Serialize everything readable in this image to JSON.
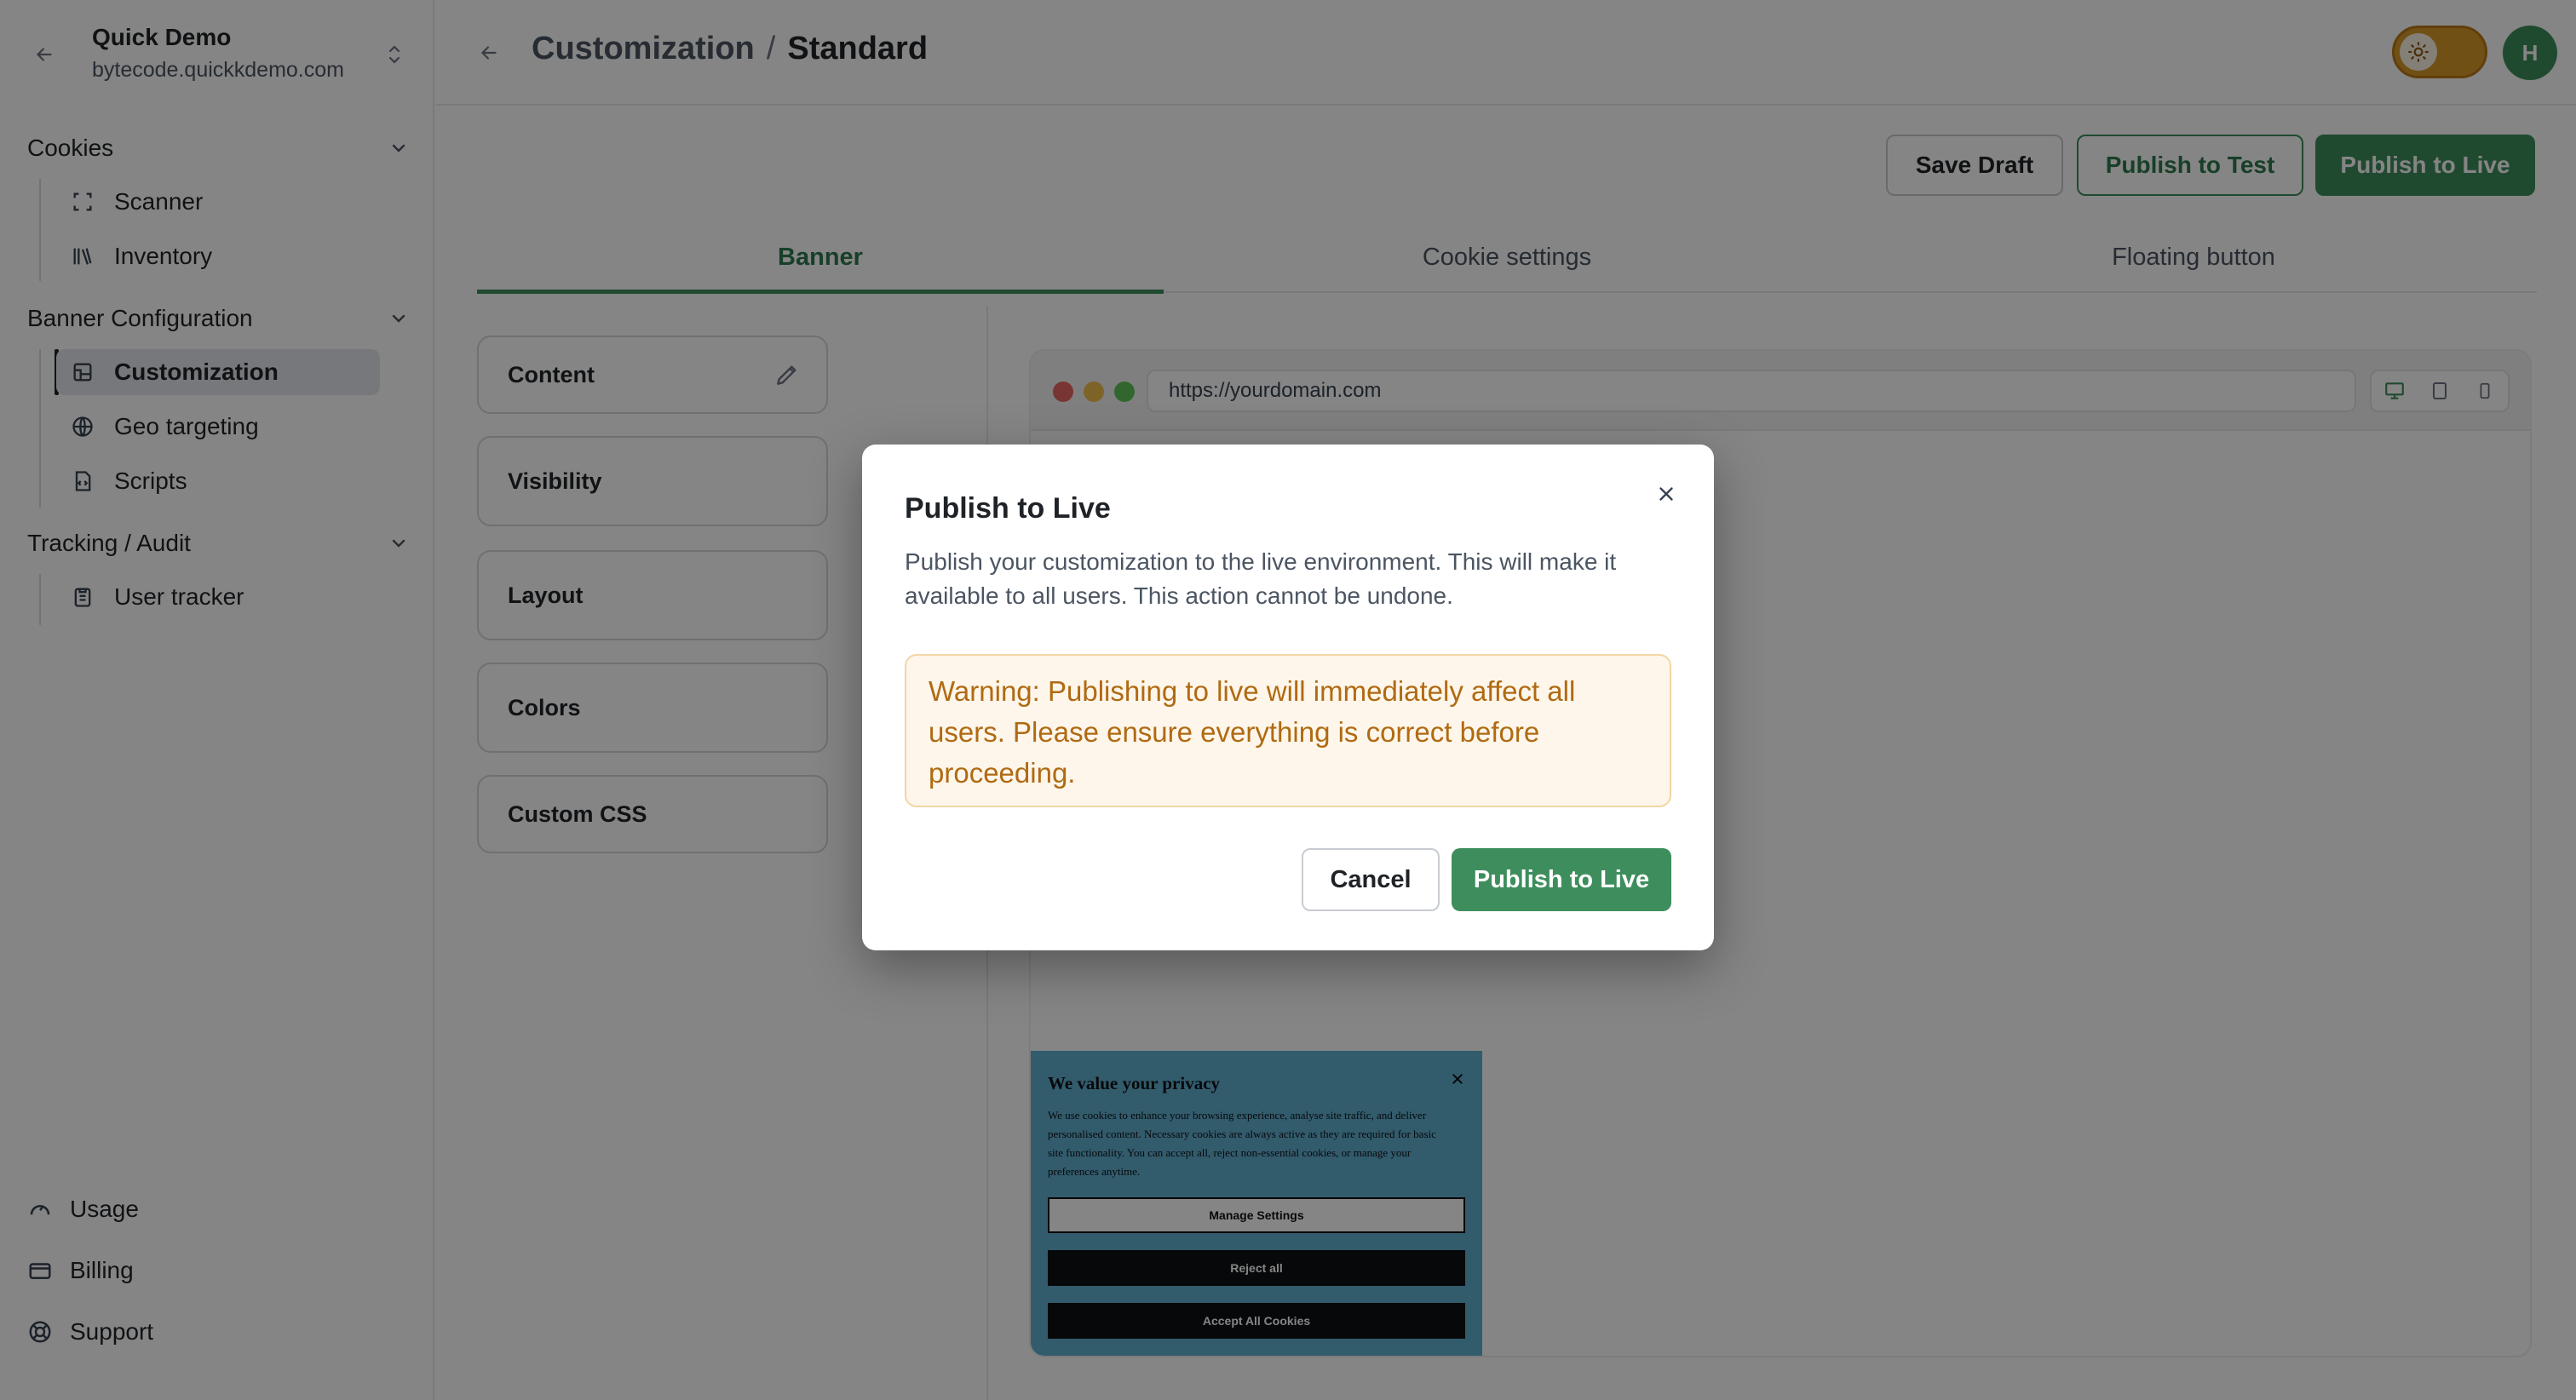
{
  "workspace": {
    "name": "Quick Demo",
    "domain": "bytecode.quickkdemo.com"
  },
  "sidebar": {
    "sections": [
      {
        "title": "Cookies",
        "items": [
          {
            "label": "Scanner",
            "icon": "scan-icon"
          },
          {
            "label": "Inventory",
            "icon": "library-icon"
          }
        ]
      },
      {
        "title": "Banner Configuration",
        "items": [
          {
            "label": "Customization",
            "icon": "palette-icon",
            "active": true
          },
          {
            "label": "Geo targeting",
            "icon": "globe-icon"
          },
          {
            "label": "Scripts",
            "icon": "file-code-icon"
          }
        ]
      },
      {
        "title": "Tracking / Audit",
        "items": [
          {
            "label": "User tracker",
            "icon": "clipboard-icon"
          }
        ]
      }
    ],
    "footer": [
      {
        "label": "Usage",
        "icon": "gauge-icon"
      },
      {
        "label": "Billing",
        "icon": "credit-card-icon"
      },
      {
        "label": "Support",
        "icon": "lifebuoy-icon"
      }
    ]
  },
  "header": {
    "breadcrumb_parent": "Customization",
    "breadcrumb_sep": "/",
    "breadcrumb_current": "Standard",
    "avatar_initial": "H"
  },
  "actions": {
    "save_draft": "Save Draft",
    "publish_test": "Publish to Test",
    "publish_live": "Publish to Live"
  },
  "tabs": [
    "Banner",
    "Cookie settings",
    "Floating button"
  ],
  "accordion": [
    "Content",
    "Visibility",
    "Layout",
    "Colors",
    "Custom CSS"
  ],
  "preview": {
    "url": "https://yourdomain.com",
    "banner": {
      "title": "We value your privacy",
      "body": "We use cookies to enhance your browsing experience, analyse site traffic, and deliver personalised content. Necessary cookies are always active as they are required for basic site functionality. You can accept all, reject non-essential cookies, or manage your preferences anytime.",
      "manage": "Manage Settings",
      "reject": "Reject all",
      "accept": "Accept All Cookies"
    }
  },
  "modal": {
    "title": "Publish to Live",
    "description": "Publish your customization to the live environment. This will make it available to all users. This action cannot be undone.",
    "warning": "Warning: Publishing to live will immediately affect all users. Please ensure everything is correct before proceeding.",
    "cancel": "Cancel",
    "confirm": "Publish to Live"
  },
  "colors": {
    "brand_green": "#3e8e5d",
    "warning_text": "#b06a12",
    "banner_bg": "#60aed0"
  }
}
